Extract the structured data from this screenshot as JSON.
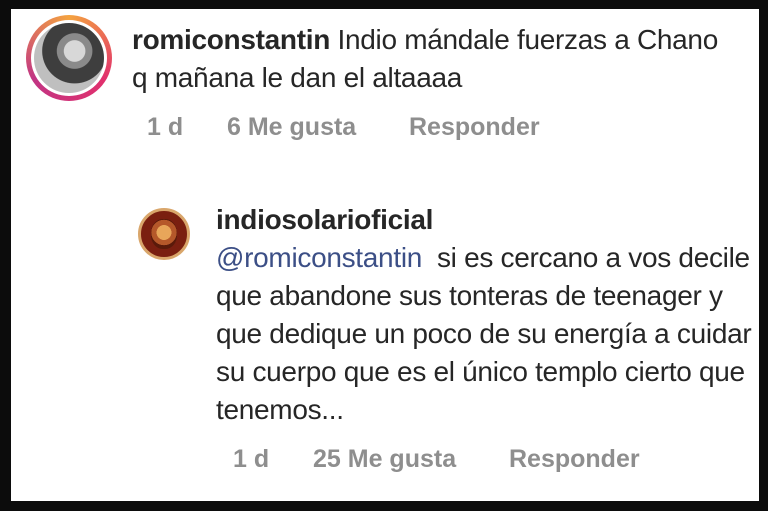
{
  "comments": [
    {
      "username": "romiconstantin",
      "text": "Indio mándale fuerzas a Chano q mañana le dan el altaaaa",
      "time": "1 d",
      "likes": "6 Me gusta",
      "reply": "Responder"
    },
    {
      "username": "indiosolarioficial",
      "mention": "@romiconstantin",
      "text": "si es cercano a vos decile que abandone sus tonteras de teenager y que dedique un poco de su energía a cuidar su cuerpo que es el único templo cierto que tenemos...",
      "time": "1 d",
      "likes": "25 Me gusta",
      "reply": "Responder"
    }
  ]
}
